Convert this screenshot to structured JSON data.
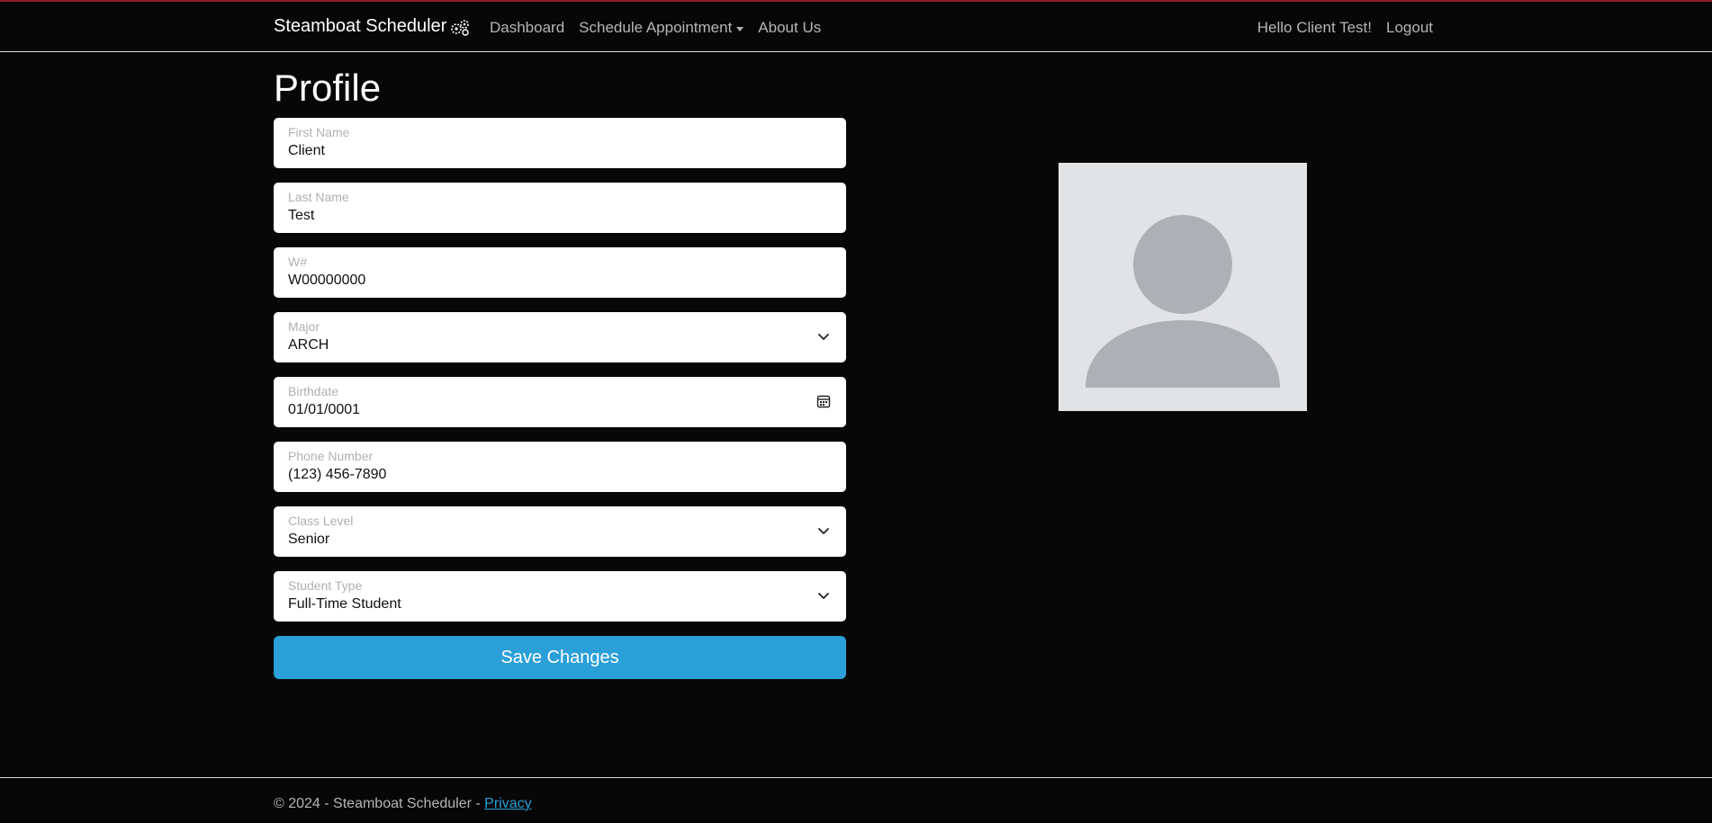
{
  "nav": {
    "brand": "Steamboat Scheduler",
    "brand_icon": "steamboat-gears-icon",
    "links": [
      "Dashboard",
      "Schedule Appointment",
      "About Us"
    ],
    "greeting": "Hello Client Test!",
    "logout": "Logout"
  },
  "page": {
    "title": "Profile"
  },
  "form": {
    "fields": [
      {
        "label": "First Name",
        "value": "Client",
        "type": "text"
      },
      {
        "label": "Last Name",
        "value": "Test",
        "type": "text"
      },
      {
        "label": "W#",
        "value": "W00000000",
        "type": "text"
      },
      {
        "label": "Major",
        "value": "ARCH",
        "type": "select"
      },
      {
        "label": "Birthdate",
        "value": "01/01/0001",
        "type": "date"
      },
      {
        "label": "Phone Number",
        "value": "(123) 456-7890",
        "type": "text"
      },
      {
        "label": "Class Level",
        "value": "Senior",
        "type": "select"
      },
      {
        "label": "Student Type",
        "value": "Full-Time Student",
        "type": "select"
      }
    ],
    "save_label": "Save Changes"
  },
  "avatar": {
    "icon": "user-silhouette-icon"
  },
  "footer": {
    "text": "© 2024 - Steamboat Scheduler - ",
    "privacy": "Privacy"
  },
  "colors": {
    "background": "#070707",
    "accent": "#2a9fd8",
    "top_line": "#8a1c2b",
    "avatar_bg": "#e2e3e5",
    "avatar_fg": "#adb1b5"
  }
}
